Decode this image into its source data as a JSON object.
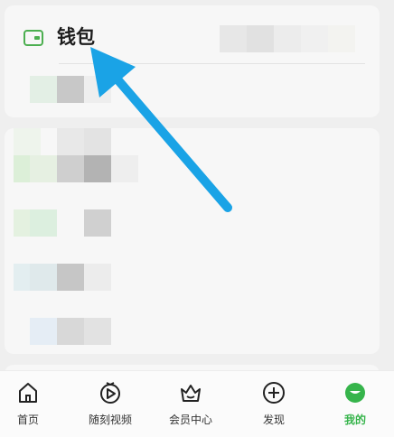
{
  "wallet": {
    "label": "钱包"
  },
  "tabs": [
    {
      "label": "首页",
      "icon": "home-icon",
      "active": false
    },
    {
      "label": "随刻视频",
      "icon": "play-circle-icon",
      "active": false
    },
    {
      "label": "会员中心",
      "icon": "crown-icon",
      "active": false
    },
    {
      "label": "发现",
      "icon": "plus-circle-icon",
      "active": false
    },
    {
      "label": "我的",
      "icon": "profile-avatar-icon",
      "active": true
    }
  ],
  "colors": {
    "accent": "#36b44b",
    "arrow": "#1aa3e6"
  }
}
